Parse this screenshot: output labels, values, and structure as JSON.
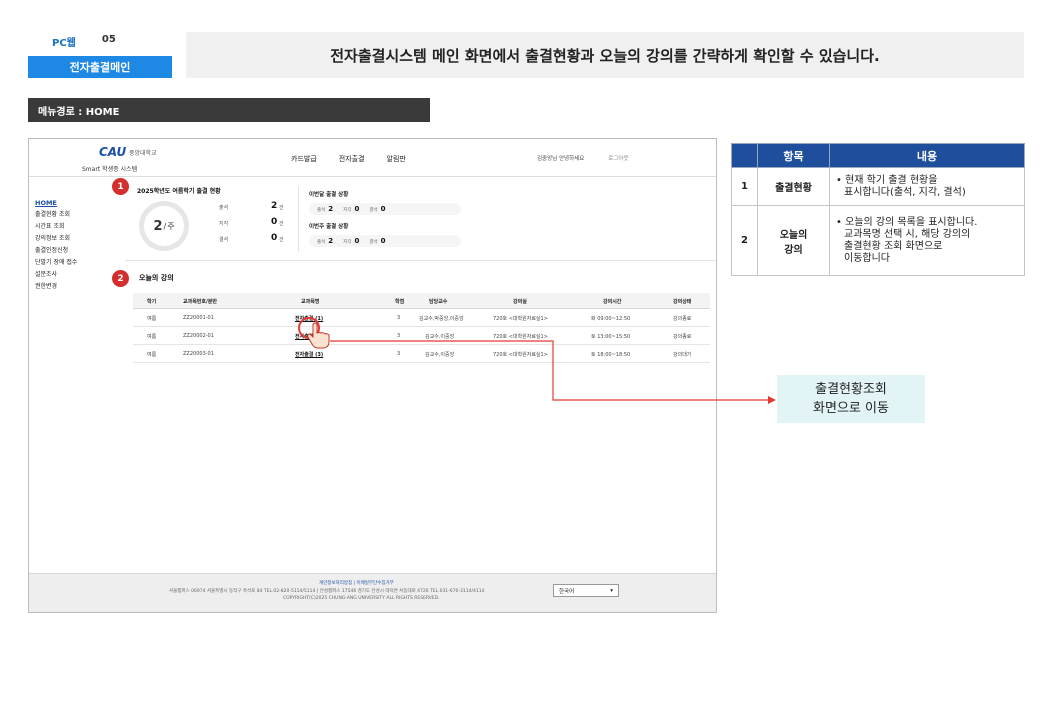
{
  "header": {
    "platform": "PC웹",
    "page_no": "05",
    "page_name": "전자출결메인",
    "description": "전자출결시스템 메인 화면에서 출결현황과 오늘의 강의를 간략하게 확인할 수 있습니다."
  },
  "menu_path": "메뉴경로 : HOME",
  "app": {
    "logo_text": "CAU",
    "university": "중앙대학교",
    "system_name": "Smart 학생증 시스템",
    "top_nav": [
      "카드발급",
      "전자출결",
      "알림판"
    ],
    "user_greeting": "김중앙님 안녕하세요",
    "logout": "로그아웃",
    "side_nav": [
      {
        "label": "HOME",
        "active": true
      },
      {
        "label": "출결현황 조회"
      },
      {
        "label": "시간표 조회"
      },
      {
        "label": "강의정보 조회"
      },
      {
        "label": "출결인정신청"
      },
      {
        "label": "단말기 장애 접수"
      },
      {
        "label": "설문조사"
      },
      {
        "label": "권한변경"
      }
    ],
    "attendance": {
      "title": "2025학년도 여름학기 출결 현황",
      "week_value": "2",
      "week_unit": "주",
      "stats": [
        {
          "label": "출석",
          "value": "2",
          "unit": "건"
        },
        {
          "label": "지각",
          "value": "0",
          "unit": "건"
        },
        {
          "label": "결석",
          "value": "0",
          "unit": "건"
        }
      ],
      "this_week_title": "이번달 출결 상황",
      "this_week": {
        "present_label": "출석",
        "present": "2",
        "late_label": "지각",
        "late": "0",
        "absent_label": "결석",
        "absent": "0"
      },
      "prev_week_title": "이번주 출결 상황",
      "prev_week": {
        "present_label": "출석",
        "present": "2",
        "late_label": "지각",
        "late": "0",
        "absent_label": "결석",
        "absent": "0"
      }
    },
    "today": {
      "title": "오늘의 강의",
      "columns": [
        "학기",
        "교과목번호/분반",
        "교과목명",
        "학점",
        "담당교수",
        "강의실",
        "강의시간",
        "강의상태"
      ],
      "rows": [
        [
          "여름",
          "ZZ20001-01",
          "전자출결 (1)",
          "3",
          "김교수,박중앙,이중앙",
          "720호 <대학원자료실1>",
          "화 09:00~12:50",
          "강의종료"
        ],
        [
          "여름",
          "ZZ20002-01",
          "전자출결 (2)",
          "3",
          "김교수,이중앙",
          "720호 <대학원자료실1>",
          "토 13:00~15:50",
          "강의종료"
        ],
        [
          "여름",
          "ZZ20003-01",
          "전자출결 (3)",
          "3",
          "김교수,이중앙",
          "720호 <대학원자료실1>",
          "토 18:00~18:50",
          "강의대기"
        ]
      ]
    },
    "footer": {
      "links": "개인정보처리방침 | 이메일무단수집거부",
      "address": "서울캠퍼스 06974 서울특별시 동작구 흑석로 84 TEL.02-820-5114/5114 | 안성캠퍼스 17546 경기도 안성시 대덕면 서동대로 4726 TEL.031-670-3114/4114",
      "copyright": "COPYRIGHT(C)2025 CHUNG-ANG UNIVERSITY ALL RIGHTS RESERVED.",
      "language": "한국어"
    }
  },
  "markers": [
    "1",
    "2"
  ],
  "info_table": {
    "headers": [
      "항목",
      "내용"
    ],
    "rows": [
      {
        "no": "1",
        "item": "출결현황",
        "desc_line1": "• 현재 학기 출결 현황을",
        "desc_line2": "표시합니다(출석, 지각, 결석)"
      },
      {
        "no": "2",
        "item_line1": "오늘의",
        "item_line2": "강의",
        "desc_line1": "• 오늘의 강의 목록을 표시합니다.",
        "desc_line2": "교과목명 선택 시, 해당 강의의",
        "desc_line3": "출결현황 조회 화면으로",
        "desc_line4": "이동합니다"
      }
    ]
  },
  "callout": {
    "line1": "출결현황조회",
    "line2": "화면으로 이동"
  },
  "colors": {
    "accent_blue": "#1e88e5",
    "table_header": "#1f4e9c",
    "marker_red": "#d32f2f",
    "callout_bg": "#e3f4f6"
  }
}
